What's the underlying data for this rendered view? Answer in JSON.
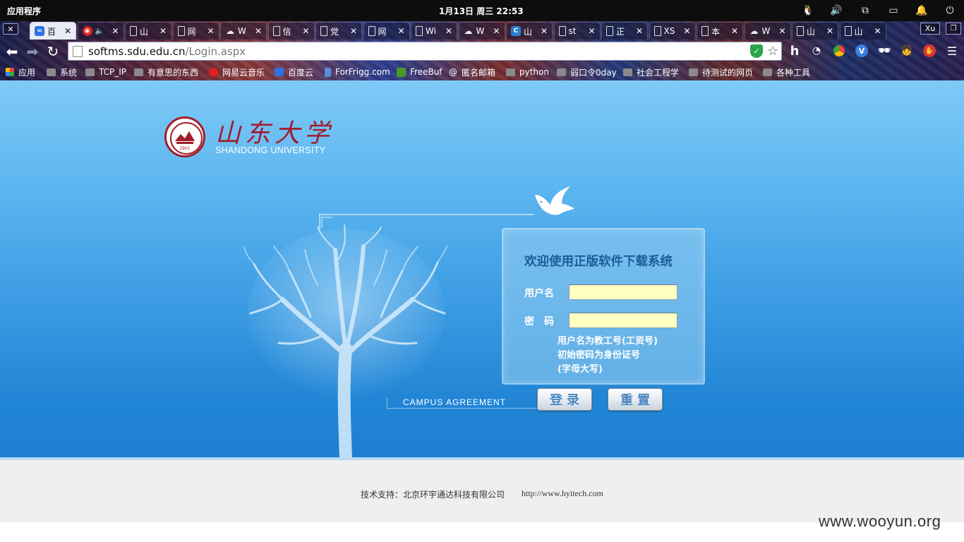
{
  "system_bar": {
    "apps_label": "应用程序",
    "clock": "1月13日 周三  22:53",
    "tray_icons": [
      "penguin-icon",
      "volume-icon",
      "network-icon",
      "battery-icon",
      "notification-bell-icon",
      "power-icon"
    ]
  },
  "tabs": [
    {
      "title": "百",
      "icon": "baidu-cloud-icon",
      "icon_color": "#2f6fe3",
      "active": true
    },
    {
      "title": "",
      "icon": "netease-music-icon",
      "icon_color": "#e02020",
      "audio": true
    },
    {
      "title": "山",
      "icon": "page-icon"
    },
    {
      "title": "网",
      "icon": "page-icon"
    },
    {
      "title": "W",
      "icon": "cloud-icon"
    },
    {
      "title": "信",
      "icon": "page-icon"
    },
    {
      "title": "党",
      "icon": "page-icon"
    },
    {
      "title": "网",
      "icon": "page-icon"
    },
    {
      "title": "Wi",
      "icon": "page-icon"
    },
    {
      "title": "W",
      "icon": "cloud-icon"
    },
    {
      "title": "山",
      "icon": "c-icon",
      "icon_color": "#2a7fd3"
    },
    {
      "title": "st",
      "icon": "page-icon"
    },
    {
      "title": "正",
      "icon": "page-icon"
    },
    {
      "title": "XS",
      "icon": "page-icon"
    },
    {
      "title": "本",
      "icon": "page-icon"
    },
    {
      "title": "W",
      "icon": "cloud-icon"
    },
    {
      "title": "山",
      "icon": "page-icon"
    },
    {
      "title": "山",
      "icon": "page-icon"
    }
  ],
  "profile": "Xu",
  "address": {
    "host": "softms.sdu.edu.cn",
    "path": "/Login.aspx"
  },
  "bookmarks": [
    {
      "label": "应用",
      "icon": "apps-grid-icon"
    },
    {
      "label": "系统",
      "icon": "folder-icon"
    },
    {
      "label": "TCP_IP",
      "icon": "folder-icon"
    },
    {
      "label": "有意思的东西",
      "icon": "folder-icon"
    },
    {
      "label": "网易云音乐",
      "icon": "netease-music-icon"
    },
    {
      "label": "百度云",
      "icon": "baidu-cloud-icon"
    },
    {
      "label": "ForFrigg.com",
      "icon": "page-icon"
    },
    {
      "label": "FreeBuf",
      "icon": "freebuf-icon"
    },
    {
      "label": "匿名邮箱",
      "icon": "at-icon"
    },
    {
      "label": "python",
      "icon": "folder-icon"
    },
    {
      "label": "弱口令0day",
      "icon": "folder-icon"
    },
    {
      "label": "社会工程学",
      "icon": "folder-icon"
    },
    {
      "label": "待测试的网页",
      "icon": "folder-icon"
    },
    {
      "label": "各种工具",
      "icon": "folder-icon"
    }
  ],
  "page": {
    "logo_chinese": "山东大学",
    "logo_english": "SHANDONG UNIVERSITY",
    "seal_year": "1901",
    "login_title": "欢迎使用正版软件下载系统",
    "username_label": "用户名",
    "password_label": "密　码",
    "username_value": "",
    "password_value": "",
    "hint_line1": "用户名为教工号(工资号)",
    "hint_line2": "初始密码为身份证号",
    "hint_line3": "(字母大写)",
    "campus_text": "CAMPUS  AGREEMENT",
    "login_button": "登录",
    "reset_button": "重置",
    "support_text": "技术支持：北京环宇通达科技有限公司",
    "support_url": "http://www.hyitech.com"
  },
  "watermark": "www.wooyun.org"
}
